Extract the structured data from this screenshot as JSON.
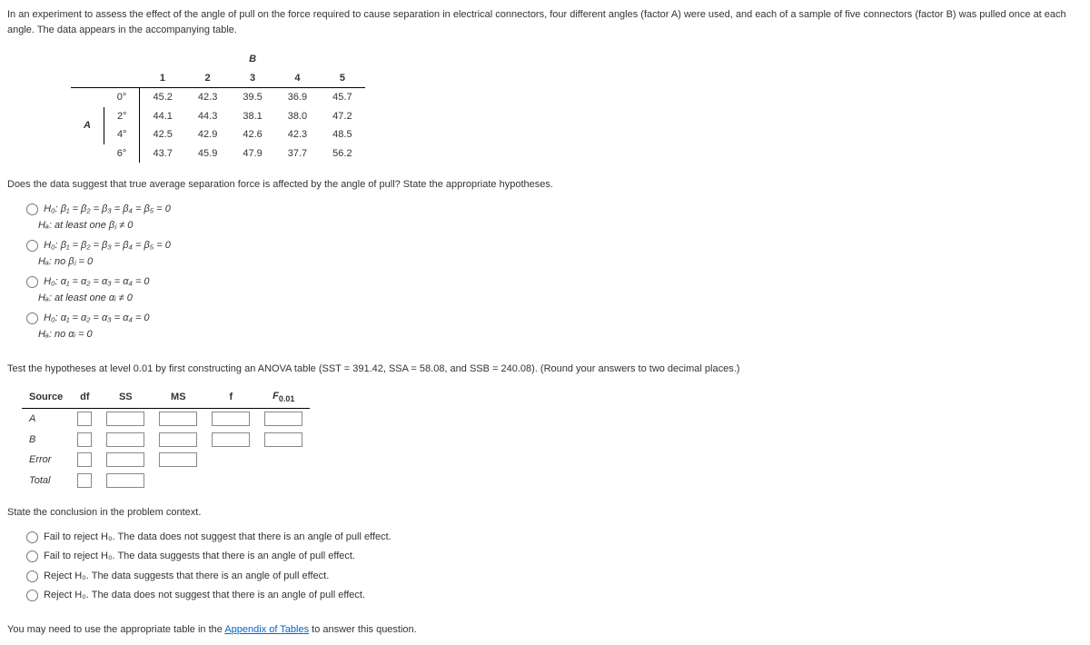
{
  "intro": "In an experiment to assess the effect of the angle of pull on the force required to cause separation in electrical connectors, four different angles (factor A) were used, and each of a sample of five connectors (factor B) was pulled once at each angle. The data appears in the accompanying table.",
  "table": {
    "B_label": "B",
    "A_label": "A",
    "cols": [
      "1",
      "2",
      "3",
      "4",
      "5"
    ],
    "rows": [
      {
        "angle": "0°",
        "vals": [
          "45.2",
          "42.3",
          "39.5",
          "36.9",
          "45.7"
        ]
      },
      {
        "angle": "2°",
        "vals": [
          "44.1",
          "44.3",
          "38.1",
          "38.0",
          "47.2"
        ]
      },
      {
        "angle": "4°",
        "vals": [
          "42.5",
          "42.9",
          "42.6",
          "42.3",
          "48.5"
        ]
      },
      {
        "angle": "6°",
        "vals": [
          "43.7",
          "45.9",
          "47.9",
          "37.7",
          "56.2"
        ]
      }
    ]
  },
  "q1": "Does the data suggest that true average separation force is affected by the angle of pull? State the appropriate hypotheses.",
  "hyp": {
    "o1_h0": "H₀: β₁ = β₂ = β₃ = β₄ = β₅ = 0",
    "o1_ha": "Hₐ: at least one βⱼ ≠ 0",
    "o2_h0": "H₀: β₁ = β₂ = β₃ = β₄ = β₅ = 0",
    "o2_ha": "Hₐ: no βⱼ = 0",
    "o3_h0": "H₀: α₁ = α₂ = α₃ = α₄ = 0",
    "o3_ha": "Hₐ: at least one αᵢ ≠ 0",
    "o4_h0": "H₀: α₁ = α₂ = α₃ = α₄ = 0",
    "o4_ha": "Hₐ: no αᵢ = 0"
  },
  "q2": "Test the hypotheses at level 0.01 by first constructing an ANOVA table (SST = 391.42, SSA = 58.08, and SSB = 240.08). (Round your answers to two decimal places.)",
  "anova": {
    "hdr": [
      "Source",
      "df",
      "SS",
      "MS",
      "f",
      "F"
    ],
    "fsub": "0.01",
    "rows": [
      "A",
      "B",
      "Error",
      "Total"
    ]
  },
  "q3": "State the conclusion in the problem context.",
  "concl": {
    "o1": "Fail to reject H₀. The data does not suggest that there is an angle of pull effect.",
    "o2": "Fail to reject H₀. The data suggests that there is an angle of pull effect.",
    "o3": "Reject H₀. The data suggests that there is an angle of pull effect.",
    "o4": "Reject H₀. The data does not suggest that there is an angle of pull effect."
  },
  "foot_pre": "You may need to use the appropriate table in the ",
  "foot_link": "Appendix of Tables",
  "foot_post": " to answer this question."
}
